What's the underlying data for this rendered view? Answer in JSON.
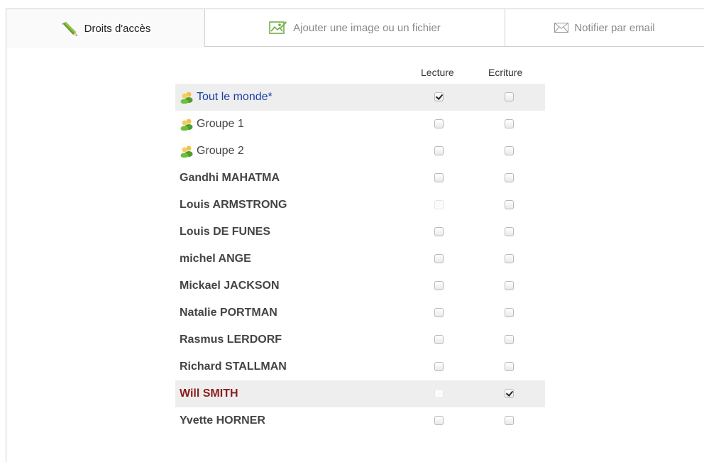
{
  "tabs": {
    "rights": "Droits d'accès",
    "file": "Ajouter une image ou un fichier",
    "email": "Notifier par email"
  },
  "columns": {
    "read": "Lecture",
    "write": "Ecriture"
  },
  "rows": [
    {
      "label": "Tout le monde*",
      "kind": "group",
      "read": "checked",
      "write": "unchecked",
      "highlight": true,
      "color": "#1a3ea8"
    },
    {
      "label": "Groupe 1",
      "kind": "group",
      "read": "unchecked",
      "write": "unchecked"
    },
    {
      "label": "Groupe 2",
      "kind": "group",
      "read": "unchecked",
      "write": "unchecked"
    },
    {
      "label": "Gandhi MAHATMA",
      "kind": "user",
      "read": "unchecked",
      "write": "unchecked"
    },
    {
      "label": "Louis ARMSTRONG",
      "kind": "user",
      "read": "disabled",
      "write": "unchecked"
    },
    {
      "label": "Louis DE FUNES",
      "kind": "user",
      "read": "unchecked",
      "write": "unchecked"
    },
    {
      "label": "michel ANGE",
      "kind": "user",
      "read": "unchecked",
      "write": "unchecked"
    },
    {
      "label": "Mickael JACKSON",
      "kind": "user",
      "read": "unchecked",
      "write": "unchecked"
    },
    {
      "label": "Natalie PORTMAN",
      "kind": "user",
      "read": "unchecked",
      "write": "unchecked"
    },
    {
      "label": "Rasmus LERDORF",
      "kind": "user",
      "read": "unchecked",
      "write": "unchecked"
    },
    {
      "label": "Richard STALLMAN",
      "kind": "user",
      "read": "unchecked",
      "write": "unchecked"
    },
    {
      "label": "Will SMITH",
      "kind": "user",
      "read": "disabled",
      "write": "checked",
      "highlight": true,
      "color": "#8b1d1d"
    },
    {
      "label": "Yvette HORNER",
      "kind": "user",
      "read": "unchecked",
      "write": "unchecked"
    }
  ],
  "icons": {
    "rights_tab": "pencil-icon",
    "file_tab": "image-file-icon",
    "email_tab": "envelope-icon",
    "group": "group-users-icon"
  }
}
